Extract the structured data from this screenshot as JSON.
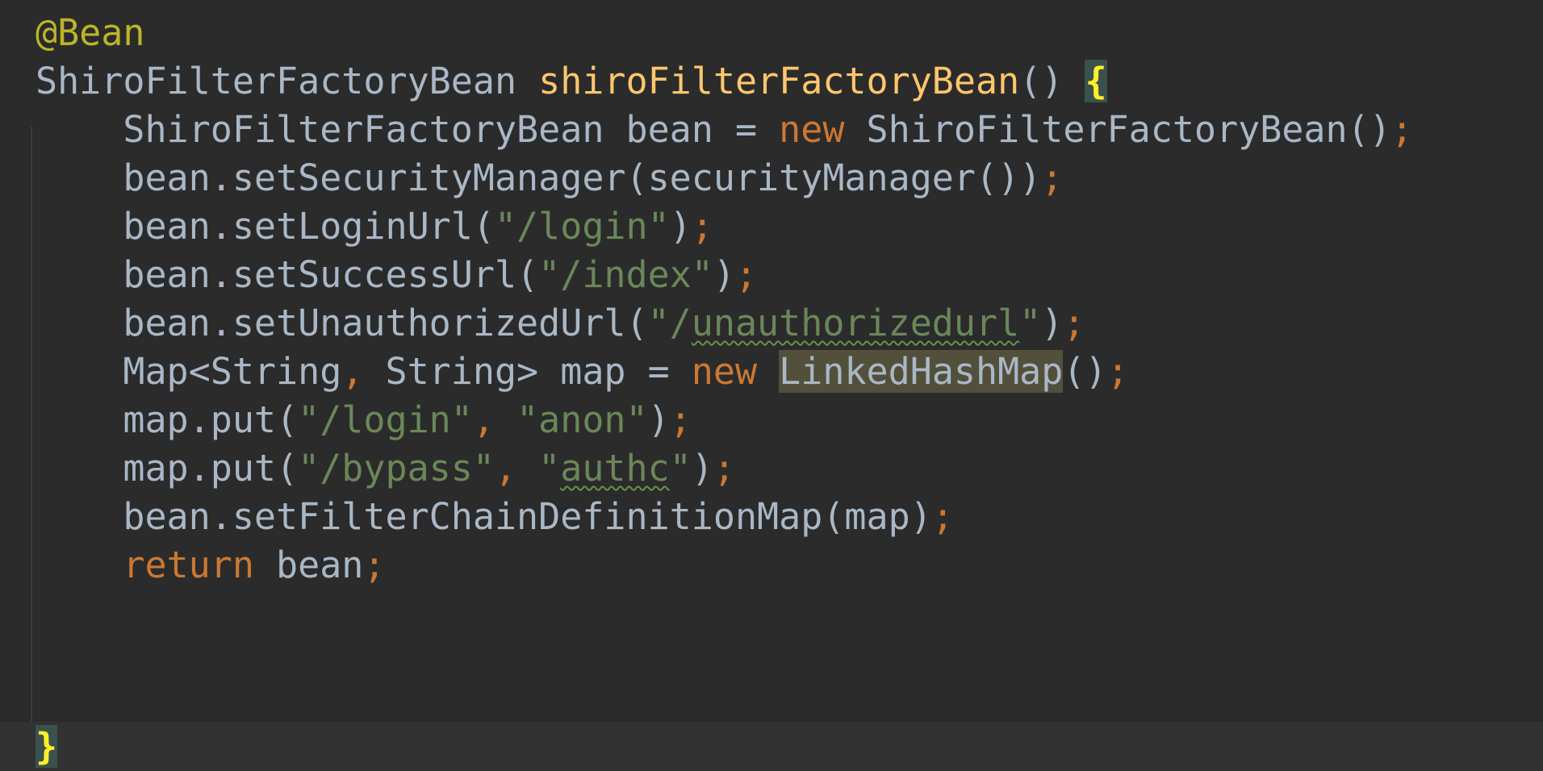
{
  "editor": {
    "theme_colors": {
      "background": "#2b2b2b",
      "text": "#a9b7c6",
      "keyword": "#cc7832",
      "string": "#6a8759",
      "annotation": "#bbb529",
      "method_decl": "#ffc66d",
      "brace_match_bg": "#3b514d",
      "usage_highlight_bg": "#52503a",
      "current_line_bg": "#323232"
    },
    "l1": {
      "annotation": "@Bean"
    },
    "l2": {
      "type": "ShiroFilterFactoryBean",
      "sp1": " ",
      "method": "shiroFilterFactoryBean",
      "parens": "()",
      "sp2": " ",
      "brace": "{"
    },
    "l3": {
      "indent": "    ",
      "type": "ShiroFilterFactoryBean",
      "mid": " bean = ",
      "kw_new": "new",
      "sp": " ",
      "ctor": "ShiroFilterFactoryBean()",
      "semi": ";"
    },
    "l4": {
      "indent": "    ",
      "code": "bean.setSecurityManager(securityManager())",
      "semi": ";"
    },
    "l5": {
      "indent": "    ",
      "code": "bean.setLoginUrl(",
      "string": "\"/login\"",
      "close": ")",
      "semi": ";"
    },
    "l6": {
      "indent": "    ",
      "code": "bean.setSuccessUrl(",
      "string": "\"/index\"",
      "close": ")",
      "semi": ";"
    },
    "l7": {
      "indent": "    ",
      "code": "bean.setUnauthorizedUrl(",
      "str_open": "\"/",
      "str_typo": "unauthorizedurl",
      "str_close": "\"",
      "close": ")",
      "semi": ";"
    },
    "l8": {
      "indent": "    ",
      "code1": "Map<String",
      "comma": ",",
      "code2": " String> map = ",
      "kw_new": "new",
      "sp": " ",
      "highlighted": "LinkedHashMap",
      "close": "()",
      "semi": ";"
    },
    "l9": {
      "indent": "    ",
      "code": "map.put(",
      "str1": "\"/login\"",
      "comma": ",",
      "sp": " ",
      "str2": "\"anon\"",
      "close": ")",
      "semi": ";"
    },
    "l10": {
      "indent": "    ",
      "code": "map.put(",
      "str1": "\"/bypass\"",
      "comma": ",",
      "sp": " ",
      "str2_open": "\"",
      "str2_typo": "authc",
      "str2_close": "\"",
      "close": ")",
      "semi": ";"
    },
    "l11": {
      "indent": "    ",
      "code": "bean.setFilterChainDefinitionMap(map)",
      "semi": ";"
    },
    "l12": {
      "indent": "    ",
      "kw_return": "return",
      "code": " bean",
      "semi": ";"
    },
    "l13": {
      "brace": "}"
    }
  }
}
